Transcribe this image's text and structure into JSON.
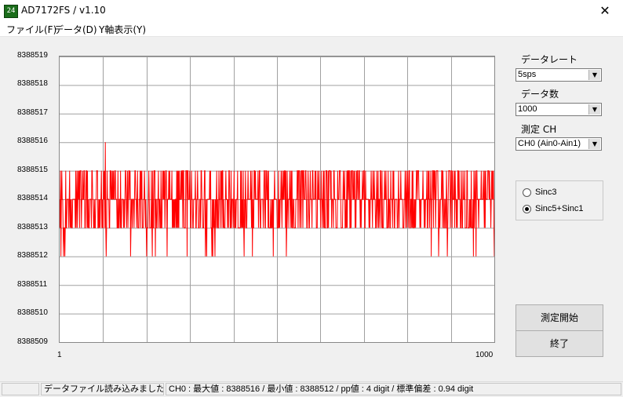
{
  "window": {
    "title": "AD7172FS / v1.10",
    "icon_text": "24",
    "close_glyph": "✕"
  },
  "menu": [
    {
      "label": "ファイル(F)"
    },
    {
      "label": "データ(D)"
    },
    {
      "label": "Y軸表示(Y)"
    }
  ],
  "controls": {
    "data_rate": {
      "label": "データレート",
      "value": "5sps"
    },
    "data_count": {
      "label": "データ数",
      "value": "1000"
    },
    "channel": {
      "label": "測定 CH",
      "value": "CH0 (Ain0-Ain1)"
    },
    "filter": {
      "options": [
        "Sinc3",
        "Sinc5+Sinc1"
      ],
      "selected": "Sinc5+Sinc1"
    },
    "start_button": "測定開始",
    "exit_button": "終了"
  },
  "status": {
    "pane1": "",
    "pane2": "データファイル読み込みました",
    "pane3": "CH0 : 最大値 : 8388516 / 最小値 : 8388512 / pp値 : 4 digit / 標準偏差 : 0.94 digit"
  },
  "chart_data": {
    "type": "line",
    "y_ticks": [
      "8388519",
      "8388518",
      "8388517",
      "8388516",
      "8388515",
      "8388514",
      "8388513",
      "8388512",
      "8388511",
      "8388510",
      "8388509"
    ],
    "x_tick_labels": [
      "1",
      "1000"
    ],
    "xlim": [
      1,
      1000
    ],
    "ylim": [
      8388509,
      8388519
    ],
    "grid": true,
    "line_color": "#ff0000",
    "series": [
      {
        "sample_count": 1000,
        "max": 8388516,
        "min": 8388512,
        "typical_band": [
          8388513,
          8388515
        ],
        "center": 8388514,
        "std_dev": 0.94
      }
    ]
  }
}
